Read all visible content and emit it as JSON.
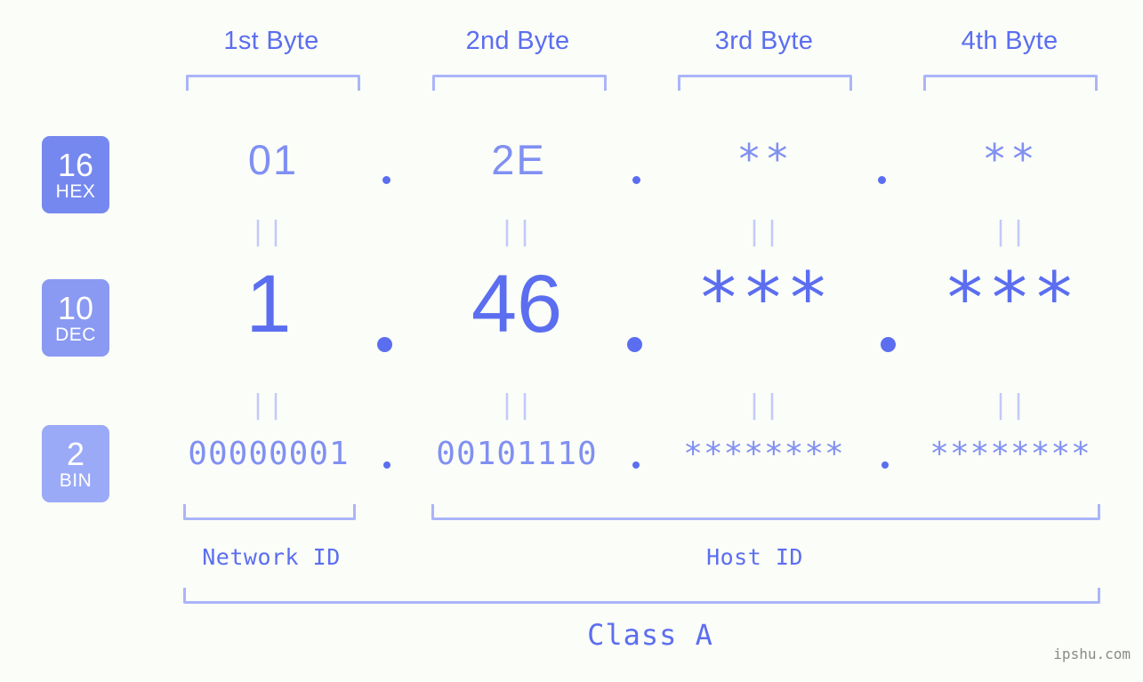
{
  "watermark": "ipshu.com",
  "columns": [
    {
      "header": "1st Byte",
      "hex": "01",
      "dec": "1",
      "bin": "00000001"
    },
    {
      "header": "2nd Byte",
      "hex": "2E",
      "dec": "46",
      "bin": "00101110"
    },
    {
      "header": "3rd Byte",
      "hex": "**",
      "dec": "***",
      "bin": "********"
    },
    {
      "header": "4th Byte",
      "hex": "**",
      "dec": "***",
      "bin": "********"
    }
  ],
  "bases": [
    {
      "num": "16",
      "unit": "HEX"
    },
    {
      "num": "10",
      "unit": "DEC"
    },
    {
      "num": "2",
      "unit": "BIN"
    }
  ],
  "separators": {
    "hex": ".",
    "dec": ".",
    "bin": "."
  },
  "equals_mark": "||",
  "segments": {
    "network_id": "Network ID",
    "host_id": "Host ID",
    "class": "Class A"
  },
  "colors": {
    "background": "#fbfdf8",
    "accent": "#5b6ef0",
    "accent_light": "#8090f2",
    "bracket": "#aab5fa",
    "equals": "#c2caf9",
    "badge_hex": "#7588ef",
    "badge_dec": "#8a99f2",
    "badge_bin": "#9aaaf7",
    "watermark": "#8a8a8a"
  }
}
